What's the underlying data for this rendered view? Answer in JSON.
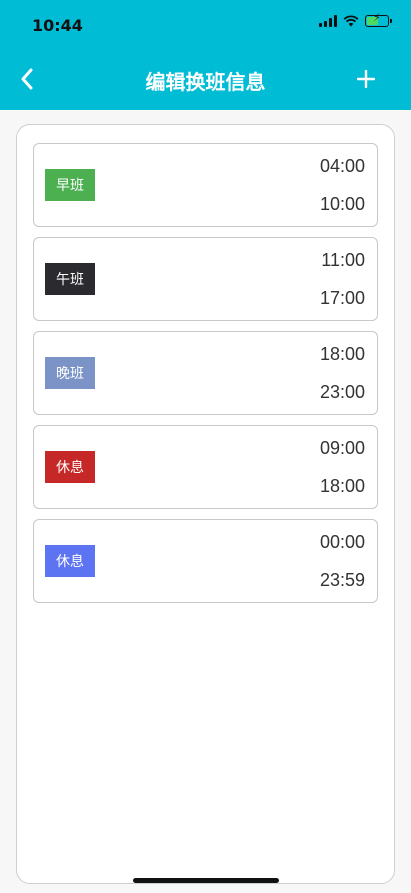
{
  "status_bar": {
    "time": "10:44"
  },
  "header": {
    "title": "编辑换班信息",
    "back_icon": "chevron-left-icon",
    "add_icon": "plus-icon"
  },
  "shifts": [
    {
      "label": "早班",
      "start": "04:00",
      "end": "10:00",
      "color": "#4caf50"
    },
    {
      "label": "午班",
      "start": "11:00",
      "end": "17:00",
      "color": "#2b2b2f"
    },
    {
      "label": "晚班",
      "start": "18:00",
      "end": "23:00",
      "color": "#7b93c6"
    },
    {
      "label": "休息",
      "start": "09:00",
      "end": "18:00",
      "color": "#c62828"
    },
    {
      "label": "休息",
      "start": "00:00",
      "end": "23:59",
      "color": "#5c73f2"
    }
  ]
}
